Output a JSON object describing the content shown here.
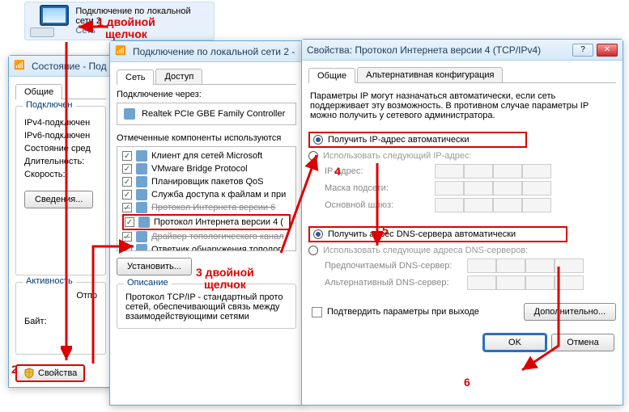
{
  "desktop_icon": {
    "title": "Подключение по локальной сети 2",
    "subtitle": "Сеть"
  },
  "annotations": {
    "a1": "1 двойной\nщелчок",
    "a2": "2",
    "a3": "3 двойной\nщелчок",
    "a4": "4",
    "a5": "5",
    "a6": "6"
  },
  "status_window": {
    "title": "Состояние - Под",
    "tab_general": "Общие",
    "group_conn": "Подключен",
    "rows": {
      "ipv4": "IPv4-подключен",
      "ipv6": "IPv6-подключен",
      "media": "Состояние сред",
      "duration": "Длительность:",
      "speed": "Скорость:"
    },
    "btn_details": "Сведения...",
    "group_activity": "Активность",
    "label_bytes": "Байт:",
    "label_sent": "Отпр",
    "btn_properties": "Свойства"
  },
  "props_window": {
    "title": "Подключение по локальной сети 2 -",
    "tab_net": "Сеть",
    "tab_access": "Доступ",
    "label_conn_via": "Подключение через:",
    "adapter": "Realtek PCIe GBE Family Controller",
    "label_components": "Отмеченные компоненты используются",
    "components": [
      "Клиент для сетей Microsoft",
      "VMware Bridge Protocol",
      "Планировщик пакетов QoS",
      "Служба доступа к файлам и при",
      "Протокол Интернета версии 6",
      "Протокол Интернета версии 4 (",
      "Драйвер топологического канал",
      "Ответчик обнаружения тополог"
    ],
    "btn_install": "Установить...",
    "group_desc": "Описание",
    "desc_text": "Протокол TCP/IP - стандартный прото сетей, обеспечивающий связь между взаимодействующими сетями"
  },
  "ipv4_window": {
    "title": "Свойства: Протокол Интернета версии 4 (TCP/IPv4)",
    "tab_general": "Общие",
    "tab_alt": "Альтернативная конфигурация",
    "note": "Параметры IP могут назначаться автоматически, если сеть поддерживает эту возможность. В противном случае параметры IP можно получить у сетевого администратора.",
    "radio_ip_auto": "Получить IP-адрес автоматически",
    "radio_ip_manual": "Использовать следующий IP-адрес:",
    "lbl_ip": "IP-адрес:",
    "lbl_mask": "Маска подсети:",
    "lbl_gw": "Основной шлюз:",
    "radio_dns_auto": "Получить адрес DNS-сервера автоматически",
    "radio_dns_manual": "Использовать следующие адреса DNS-серверов:",
    "lbl_dns1": "Предпочитаемый DNS-сервер:",
    "lbl_dns2": "Альтернативный DNS-сервер:",
    "chk_validate": "Подтвердить параметры при выходе",
    "btn_adv": "Дополнительно...",
    "btn_ok": "OK",
    "btn_cancel": "Отмена"
  }
}
